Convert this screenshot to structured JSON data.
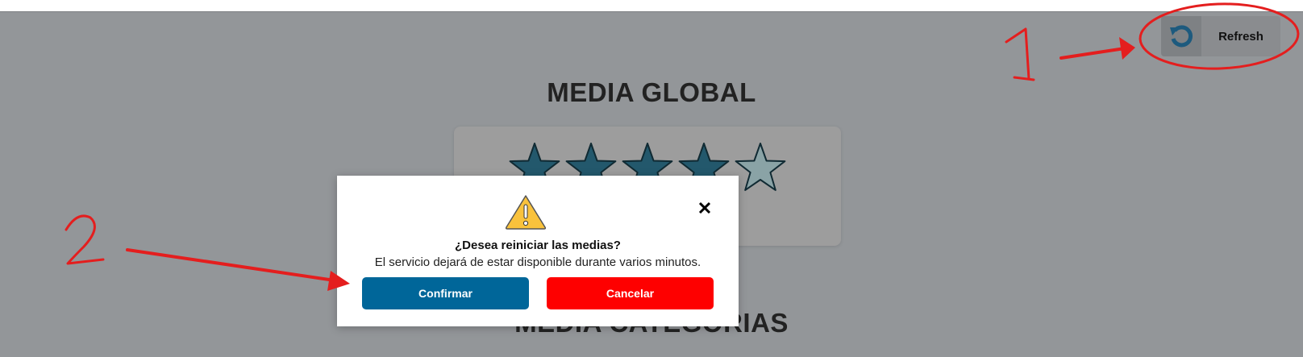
{
  "header": {
    "refresh_label": "Refresh",
    "refresh_icon": "refresh-icon"
  },
  "sections": {
    "global_title": "MEDIA GLOBAL",
    "categories_title": "MEDIA CATEGORIAS"
  },
  "rating": {
    "filled_stars": 4,
    "total_stars": 5,
    "filled_color": "#23586c",
    "empty_color": "#8aa3a6"
  },
  "dialog": {
    "icon": "warning-icon",
    "question": "¿Desea reiniciar las medias?",
    "message": "El servicio dejará de estar disponible durante varios minutos.",
    "confirm_label": "Confirmar",
    "cancel_label": "Cancelar",
    "confirm_color": "#006699",
    "cancel_color": "#fe0000"
  },
  "annotations": {
    "marker_1": "1",
    "marker_2": "2",
    "color": "#e41e1e"
  }
}
